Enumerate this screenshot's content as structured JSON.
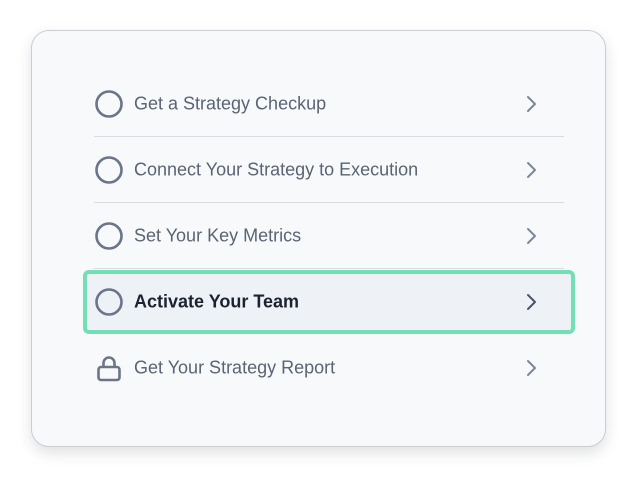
{
  "steps": {
    "items": [
      {
        "label": "Get a Strategy Checkup",
        "icon": "circle-icon",
        "state": "incomplete"
      },
      {
        "label": "Connect Your Strategy to Execution",
        "icon": "circle-icon",
        "state": "incomplete"
      },
      {
        "label": "Set Your Key Metrics",
        "icon": "circle-icon",
        "state": "incomplete"
      },
      {
        "label": "Activate Your Team",
        "icon": "circle-icon",
        "state": "active"
      },
      {
        "label": "Get Your Strategy Report",
        "icon": "lock-icon",
        "state": "locked"
      }
    ],
    "chevron_icon": "chevron-right-icon"
  },
  "colors": {
    "text": "#5a6475",
    "text_active": "#1c2330",
    "icon": "#6b7589",
    "highlight_border": "#72dfb4",
    "divider": "#d9dde3",
    "card_background": "#f7f9fb"
  }
}
